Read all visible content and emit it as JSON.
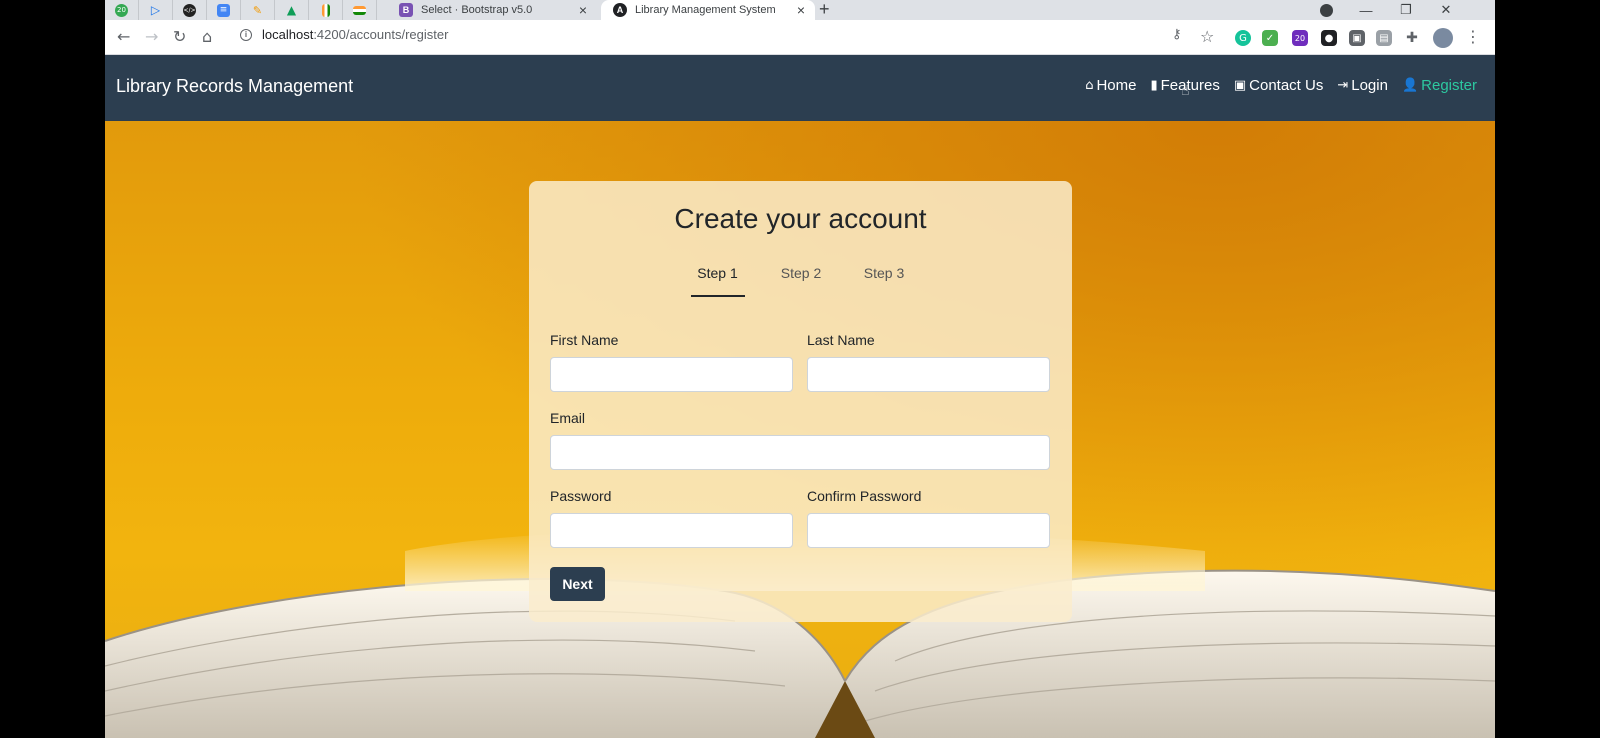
{
  "browser": {
    "tabs": [
      {
        "title": "Select · Bootstrap v5.0",
        "favicon": "B"
      },
      {
        "title": "Library Management System",
        "favicon": "A"
      }
    ],
    "pinned_badge": "20",
    "address": {
      "host": "localhost",
      "path": ":4200/accounts/register"
    },
    "extension_badge": "20"
  },
  "navbar": {
    "brand": "Library Records Management",
    "links": [
      {
        "label": "Home",
        "icon": "home-icon"
      },
      {
        "label": "Features",
        "icon": "clipboard-icon"
      },
      {
        "label": "Contact Us",
        "icon": "contact-card-icon"
      },
      {
        "label": "Login",
        "icon": "sign-in-icon"
      },
      {
        "label": "Register",
        "icon": "user-plus-icon"
      }
    ]
  },
  "form": {
    "title": "Create your account",
    "steps": [
      "Step 1",
      "Step 2",
      "Step 3"
    ],
    "active_step": 1,
    "fields": {
      "first_name": {
        "label": "First Name",
        "value": ""
      },
      "last_name": {
        "label": "Last Name",
        "value": ""
      },
      "email": {
        "label": "Email",
        "value": ""
      },
      "password": {
        "label": "Password",
        "value": ""
      },
      "confirm_password": {
        "label": "Confirm Password",
        "value": ""
      }
    },
    "next_label": "Next"
  },
  "colors": {
    "navbar": "#2c3e50",
    "active_link": "#2dc9a0",
    "hero": "#eeac0c"
  }
}
